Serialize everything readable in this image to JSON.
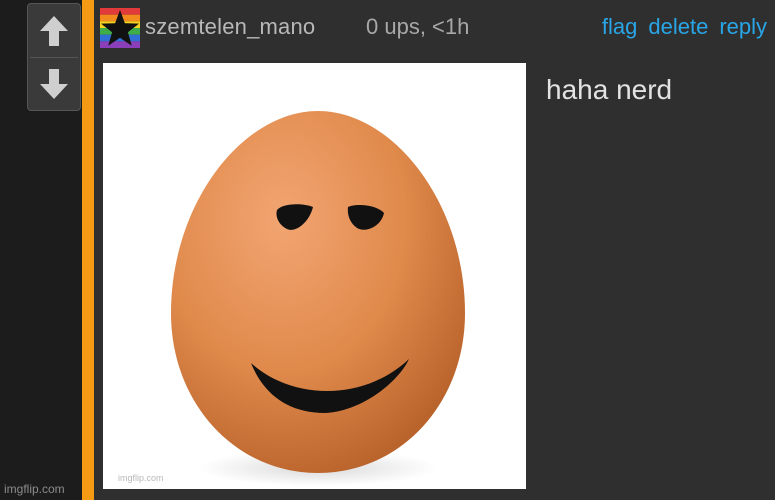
{
  "comment": {
    "username": "szemtelen_mano",
    "meta": "0 ups, <1h",
    "actions": {
      "flag": "flag",
      "delete": "delete",
      "reply": "reply"
    },
    "text": "haha nerd",
    "image_watermark": "imgflip.com"
  },
  "vote": {
    "up_icon": "arrow-up-icon",
    "down_icon": "arrow-down-icon"
  },
  "site_watermark": "imgflip.com",
  "colors": {
    "accent": "#f59a13",
    "link": "#29a6e8",
    "background": "#2f2f2f"
  }
}
